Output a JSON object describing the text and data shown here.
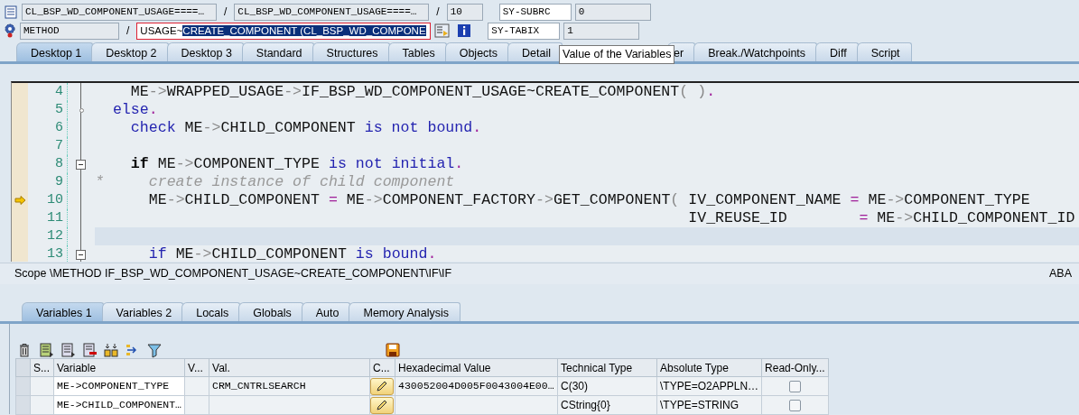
{
  "header": {
    "rows": [
      {
        "fields": [
          {
            "kind": "field",
            "text": "CL_BSP_WD_COMPONENT_USAGE====…"
          },
          {
            "kind": "sep",
            "text": "/"
          },
          {
            "kind": "field",
            "text": "CL_BSP_WD_COMPONENT_USAGE====…"
          },
          {
            "kind": "sep",
            "text": "/"
          },
          {
            "kind": "field",
            "text": "10"
          },
          {
            "kind": "name",
            "text": "SY-SUBRC"
          },
          {
            "kind": "field",
            "text": "0"
          }
        ]
      },
      {
        "fields": [
          {
            "kind": "field",
            "text": "METHOD"
          },
          {
            "kind": "sep",
            "text": "/"
          },
          {
            "kind": "selection",
            "text": "USAGE~",
            "highlighted": "CREATE_COMPONENT (CL_BSP_WD_COMPONE"
          },
          {
            "kind": "display"
          },
          {
            "kind": "info"
          },
          {
            "kind": "name",
            "text": "SY-TABIX"
          },
          {
            "kind": "field",
            "text": "1"
          }
        ]
      }
    ]
  },
  "desktop_tabs": [
    {
      "label": "Desktop 1",
      "selected": true
    },
    {
      "label": "Desktop 2",
      "selected": false
    },
    {
      "label": "Desktop 3",
      "selected": false
    },
    {
      "label": "Standard",
      "selected": false
    },
    {
      "label": "Structures",
      "selected": false
    },
    {
      "label": "Tables",
      "selected": false
    },
    {
      "label": "Objects",
      "selected": false
    },
    {
      "label": "Detail",
      "selected": false
    },
    {
      "label": "er",
      "selected": false
    },
    {
      "label": "Break./Watchpoints",
      "selected": false
    },
    {
      "label": "Diff",
      "selected": false
    },
    {
      "label": "Script",
      "selected": false
    }
  ],
  "tooltip": {
    "text": "Value of the Variables"
  },
  "code": {
    "lines": [
      {
        "number": "4",
        "collapsible": false,
        "branch": false,
        "current_statement": false,
        "highlighted": false,
        "segments": [
          {
            "kind": "code",
            "text": "    ME"
          },
          {
            "kind": "arrow",
            "text": "->"
          },
          {
            "kind": "code",
            "text": "WRAPPED_USAGE"
          },
          {
            "kind": "arrow",
            "text": "->"
          },
          {
            "kind": "code",
            "text": "IF_BSP_WD_COMPONENT_USAGE~CREATE_COMPONENT"
          },
          {
            "kind": "arrow",
            "text": "( )"
          },
          {
            "kind": "op",
            "text": "."
          }
        ]
      },
      {
        "number": "5",
        "collapsible": false,
        "branch": true,
        "current_statement": false,
        "highlighted": false,
        "segments": [
          {
            "kind": "keyword",
            "text": "  else"
          },
          {
            "kind": "op",
            "text": "."
          }
        ]
      },
      {
        "number": "6",
        "collapsible": false,
        "branch": false,
        "current_statement": false,
        "highlighted": false,
        "segments": [
          {
            "kind": "keyword",
            "text": "    check"
          },
          {
            "kind": "code",
            "text": " ME"
          },
          {
            "kind": "arrow",
            "text": "->"
          },
          {
            "kind": "code",
            "text": "CHILD_COMPONENT "
          },
          {
            "kind": "keyword",
            "text": "is not bound"
          },
          {
            "kind": "op",
            "text": "."
          }
        ]
      },
      {
        "number": "7",
        "collapsible": false,
        "branch": false,
        "current_statement": false,
        "highlighted": false
      },
      {
        "number": "8",
        "collapsible": true,
        "branch": false,
        "current_statement": false,
        "highlighted": false,
        "segments": [
          {
            "kind": "strong",
            "text": "    if"
          },
          {
            "kind": "code",
            "text": " ME"
          },
          {
            "kind": "arrow",
            "text": "->"
          },
          {
            "kind": "code",
            "text": "COMPONENT_TYPE "
          },
          {
            "kind": "keyword",
            "text": "is not initial"
          },
          {
            "kind": "op",
            "text": "."
          }
        ]
      },
      {
        "number": "9",
        "collapsible": false,
        "branch": false,
        "current_statement": false,
        "highlighted": false,
        "segments": [
          {
            "kind": "comment",
            "text": "*     create instance of child component"
          }
        ]
      },
      {
        "number": "10",
        "collapsible": false,
        "branch": false,
        "current_statement": true,
        "highlighted": false,
        "segments": [
          {
            "kind": "code",
            "text": "      ME"
          },
          {
            "kind": "arrow",
            "text": "->"
          },
          {
            "kind": "code",
            "text": "CHILD_COMPONENT "
          },
          {
            "kind": "op",
            "text": "="
          },
          {
            "kind": "code",
            "text": " ME"
          },
          {
            "kind": "arrow",
            "text": "->"
          },
          {
            "kind": "code",
            "text": "COMPONENT_FACTORY"
          },
          {
            "kind": "arrow",
            "text": "->"
          },
          {
            "kind": "code",
            "text": "GET_COMPONENT"
          },
          {
            "kind": "arrow",
            "text": "("
          },
          {
            "kind": "code",
            "text": " IV_COMPONENT_NAME "
          },
          {
            "kind": "op",
            "text": "="
          },
          {
            "kind": "code",
            "text": " ME"
          },
          {
            "kind": "arrow",
            "text": "->"
          },
          {
            "kind": "code",
            "text": "COMPONENT_TYPE"
          }
        ]
      },
      {
        "number": "11",
        "collapsible": false,
        "branch": false,
        "current_statement": false,
        "highlighted": false,
        "segments": [
          {
            "kind": "code",
            "text": "                                                                  IV_REUSE_ID        "
          },
          {
            "kind": "op",
            "text": "="
          },
          {
            "kind": "code",
            "text": " ME"
          },
          {
            "kind": "arrow",
            "text": "->"
          },
          {
            "kind": "code",
            "text": "CHILD_COMPONENT_ID"
          }
        ]
      },
      {
        "number": "12",
        "collapsible": false,
        "branch": false,
        "current_statement": false,
        "highlighted": true
      },
      {
        "number": "13",
        "collapsible": true,
        "branch": false,
        "current_statement": false,
        "highlighted": false,
        "segments": [
          {
            "kind": "keyword",
            "text": "      if"
          },
          {
            "kind": "code",
            "text": " ME"
          },
          {
            "kind": "arrow",
            "text": "->"
          },
          {
            "kind": "code",
            "text": "CHILD_COMPONENT "
          },
          {
            "kind": "keyword",
            "text": "is bound"
          },
          {
            "kind": "op",
            "text": "."
          }
        ]
      }
    ]
  },
  "scope": {
    "text": "Scope \\METHOD IF_BSP_WD_COMPONENT_USAGE~CREATE_COMPONENT\\IF\\IF",
    "editor_mode": "ABA"
  },
  "variable_tabs": [
    {
      "label": "Variables 1",
      "selected": true
    },
    {
      "label": "Variables 2",
      "selected": false
    },
    {
      "label": "Locals",
      "selected": false
    },
    {
      "label": "Globals",
      "selected": false
    },
    {
      "label": "Auto",
      "selected": false
    },
    {
      "label": "Memory Analysis",
      "selected": false
    }
  ],
  "table": {
    "columns": [
      "S...",
      "Variable",
      "V...",
      "Val.",
      "C...",
      "Hexadecimal Value",
      "Technical Type",
      "Absolute Type",
      "Read-Only..."
    ],
    "rows": [
      {
        "variable": "ME->COMPONENT_TYPE",
        "value": "CRM_CNTRLSEARCH",
        "hex": "430052004D005F0043004E00…",
        "technical_type": "C(30)",
        "absolute_type": "\\TYPE=O2APPLN…",
        "read_only": false
      },
      {
        "variable": "ME->CHILD_COMPONENT…",
        "hex": "",
        "technical_type": "CString{0}",
        "absolute_type": "\\TYPE=STRING",
        "read_only": false
      }
    ]
  }
}
